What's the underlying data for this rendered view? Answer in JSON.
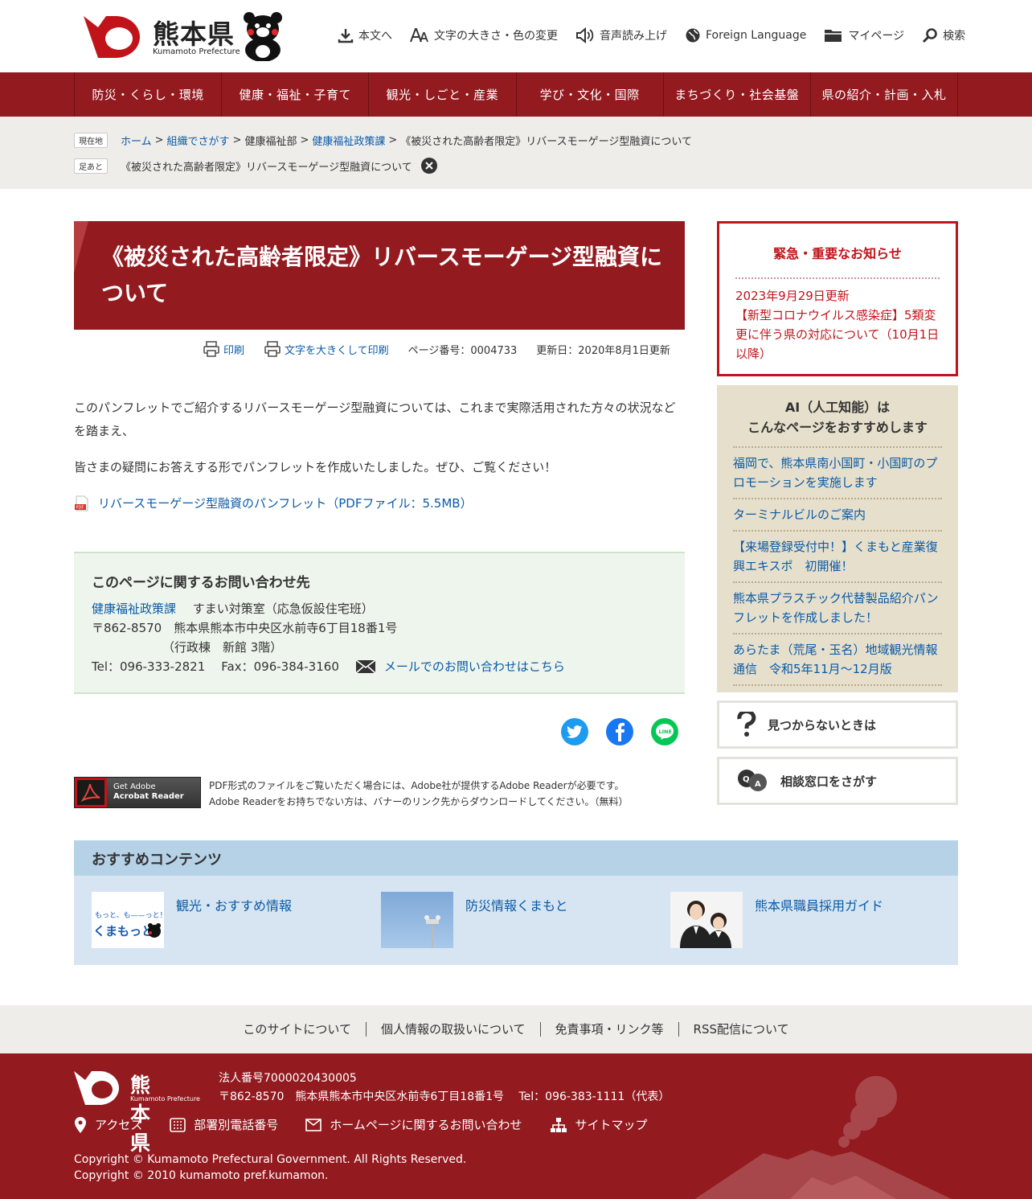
{
  "header": {
    "logo_title": "熊本県",
    "logo_sub": "Kumamoto Prefecture",
    "utility": {
      "body": "本文へ",
      "textsize": "文字の大きさ・色の変更",
      "speech": "音声読み上げ",
      "foreign": "Foreign Language",
      "mypage": "マイページ",
      "search": "検索"
    }
  },
  "globalnav": [
    "防災・くらし・環境",
    "健康・福祉・子育て",
    "観光・しごと・産業",
    "学び・文化・国際",
    "まちづくり・社会基盤",
    "県の紹介・計画・入札"
  ],
  "breadcrumb": {
    "current_tag": "現在地",
    "home": "ホーム",
    "org": "組織でさがす",
    "dept": "健康福祉部",
    "division": "健康福祉政策課",
    "page": "《被災された高齢者限定》リバースモーゲージ型融資について",
    "history_tag": "足あと",
    "history_item": "《被災された高齢者限定》リバースモーゲージ型融資について",
    "sep": ">"
  },
  "page": {
    "title": "《被災された高齢者限定》リバースモーゲージ型融資について",
    "print": "印刷",
    "print_large": "文字を大きくして印刷",
    "page_number": "ページ番号：0004733",
    "updated": "更新日：2020年8月1日更新",
    "paragraph1": "このパンフレットでご紹介するリバースモーゲージ型融資については、これまで実際活用された方々の状況などを踏まえ、",
    "paragraph2": "皆さまの疑問にお答えする形でパンフレットを作成いたしました。ぜひ、ご覧ください！",
    "pdf_link": "リバースモーゲージ型融資のパンフレット（PDFファイル：5.5MB）"
  },
  "contact": {
    "title": "このページに関するお問い合わせ先",
    "division_link": "健康福祉政策課",
    "section": "すまい対策室（応急仮設住宅班）",
    "address": "〒862-8570　熊本県熊本市中央区水前寺6丁目18番1号",
    "building": "（行政棟　新館 3階）",
    "tel": "Tel：096-333-2821",
    "fax": "Fax：096-384-3160",
    "mail_link": "メールでのお問い合わせはこちら"
  },
  "adobe": {
    "banner_line1": "Get Adobe",
    "banner_line2": "Acrobat Reader",
    "text1": "PDF形式のファイルをご覧いただく場合には、Adobe社が提供するAdobe Readerが必要です。",
    "text2": "Adobe Readerをお持ちでない方は、バナーのリンク先からダウンロードしてください。（無料）"
  },
  "notice": {
    "title": "緊急・重要なお知らせ",
    "date": "2023年9月29日更新",
    "body": "【新型コロナウイルス感染症】5類変更に伴う県の対応について（10月1日以降）"
  },
  "ai": {
    "title_line1": "AI（人工知能）は",
    "title_line2": "こんなページをおすすめします",
    "items": [
      "福岡で、熊本県南小国町・小国町のプロモーションを実施します",
      "ターミナルビルのご案内",
      "【来場登録受付中！】くまもと産業復興エキスポ　初開催！",
      "熊本県プラスチック代替製品紹介パンフレットを作成しました！",
      "あらたま（荒尾・玉名）地域観光情報通信　令和5年11月～12月版"
    ]
  },
  "side_buttons": {
    "notfound": "見つからないときは",
    "consult": "相談窓口をさがす"
  },
  "recommend": {
    "title": "おすすめコンテンツ",
    "items": [
      {
        "label": "観光・おすすめ情報",
        "thumb_text1": "もっと、も——っと！",
        "thumb_text2": "くまもっと。"
      },
      {
        "label": "防災情報くまもと"
      },
      {
        "label": "熊本県職員採用ガイド"
      }
    ]
  },
  "footnav": [
    "このサイトについて",
    "個人情報の取扱いについて",
    "免責事項・リンク等",
    "RSS配信について"
  ],
  "footer": {
    "logo_title": "熊本県",
    "logo_sub": "Kumamoto Prefecture",
    "corp_no": "法人番号7000020430005",
    "address": "〒862-8570　熊本県熊本市中央区水前寺6丁目18番1号　 Tel：096-383-1111（代表）",
    "links": [
      "アクセス",
      "部署別電話番号",
      "ホームページに関するお問い合わせ",
      "サイトマップ"
    ],
    "copyright1": "Copyright © Kumamoto Prefectural Government. All Rights Reserved.",
    "copyright2": "Copyright © 2010 kumamoto pref.kumamon."
  },
  "colors": {
    "brand_red": "#931a1f",
    "notice_red": "#c0141a",
    "link_blue": "#0a5aa8"
  }
}
